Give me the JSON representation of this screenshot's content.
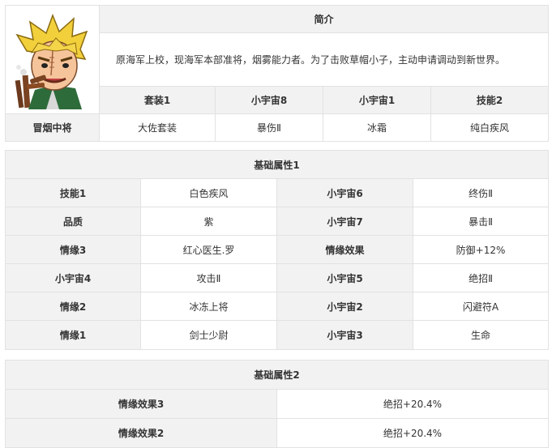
{
  "profile": {
    "name": "冒烟中将",
    "intro_header": "简介",
    "intro_text": "原海军上校，现海军本部准将，烟雾能力者。为了击败草帽小子，主动申请调动到新世界。",
    "headers": [
      "套装1",
      "小宇宙8",
      "小宇宙1",
      "技能2"
    ],
    "values": [
      "大佐套装",
      "暴伤Ⅱ",
      "冰霜",
      "纯白疾风"
    ]
  },
  "attr1": {
    "title": "基础属性1",
    "rows": [
      [
        "技能1",
        "白色疾风",
        "小宇宙6",
        "终伤Ⅱ"
      ],
      [
        "品质",
        "紫",
        "小宇宙7",
        "暴击Ⅱ"
      ],
      [
        "情缘3",
        "红心医生.罗",
        "情缘效果",
        "防御+12%"
      ],
      [
        "小宇宙4",
        "攻击Ⅱ",
        "小宇宙5",
        "绝招Ⅱ"
      ],
      [
        "情缘2",
        "冰冻上将",
        "小宇宙2",
        "闪避符A"
      ],
      [
        "情缘1",
        "剑士少尉",
        "小宇宙3",
        "生命"
      ]
    ]
  },
  "attr2": {
    "title": "基础属性2",
    "rows": [
      [
        "情缘效果3",
        "绝招+20.4%"
      ],
      [
        "情缘效果2",
        "绝招+20.4%"
      ]
    ]
  }
}
